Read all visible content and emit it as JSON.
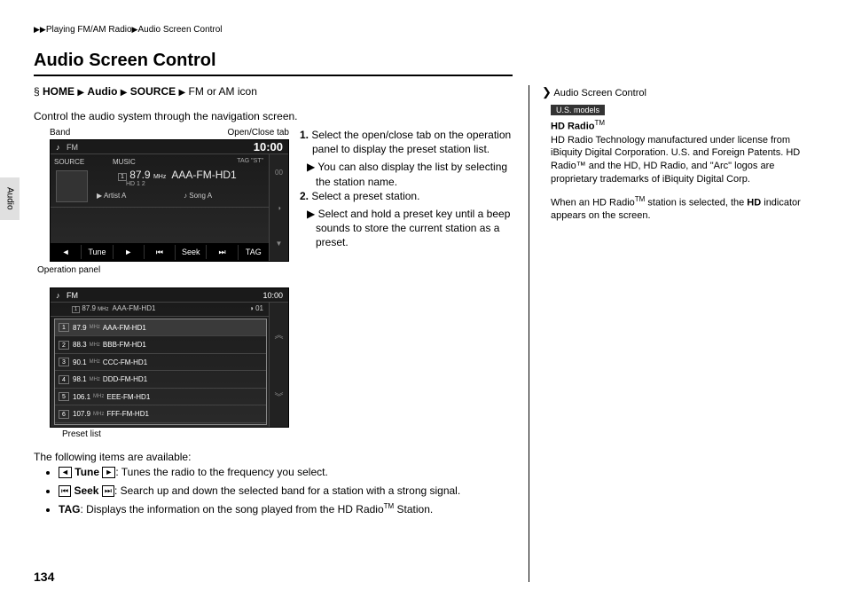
{
  "breadcrumb": {
    "section": "Playing FM/AM Radio",
    "sub": "Audio Screen Control"
  },
  "title": "Audio Screen Control",
  "side_tab": "Audio",
  "page_number": "134",
  "nav_path": {
    "home": "HOME",
    "audio": "Audio",
    "source": "SOURCE",
    "tail": "FM or AM icon"
  },
  "intro": "Control the audio system through the navigation screen.",
  "callouts": {
    "band": "Band",
    "open_close": "Open/Close tab",
    "operation_panel": "Operation panel",
    "preset_list": "Preset list"
  },
  "screen1": {
    "band": "FM",
    "clock": "10:00",
    "source": "SOURCE",
    "music": "MUSIC",
    "freq_num": "87.9",
    "freq_unit": "MHz",
    "station": "AAA-FM-HD1",
    "hd_ind": "HD 1 2",
    "artist_label": "Artist A",
    "song_label": "Song A",
    "tag_st": "TAG \"ST\"",
    "right_val": "00",
    "bottom": {
      "tune": "Tune",
      "seek": "Seek",
      "tag": "TAG"
    }
  },
  "screen2": {
    "band": "FM",
    "clock": "10:00",
    "now_freq": "87.9",
    "now_unit": "MHz",
    "now_station": "AAA-FM-HD1",
    "right_val": "01",
    "presets": [
      {
        "n": "1",
        "f": "87.9",
        "name": "AAA-FM-HD1"
      },
      {
        "n": "2",
        "f": "88.3",
        "name": "BBB-FM-HD1"
      },
      {
        "n": "3",
        "f": "90.1",
        "name": "CCC-FM-HD1"
      },
      {
        "n": "4",
        "f": "98.1",
        "name": "DDD-FM-HD1"
      },
      {
        "n": "5",
        "f": "106.1",
        "name": "EEE-FM-HD1"
      },
      {
        "n": "6",
        "f": "107.9",
        "name": "FFF-FM-HD1"
      }
    ]
  },
  "steps": {
    "s1": "Select the open/close tab on the operation panel to display the preset station list.",
    "s1sub": "You can also display the list by selecting the station name.",
    "s2": "Select a preset station.",
    "s2sub": "Select and hold a preset key until a beep sounds to store the current station as a preset.",
    "n1": "1.",
    "n2": "2."
  },
  "available": {
    "heading": "The following items are available:",
    "tune_label": "Tune",
    "tune_desc": ": Tunes the radio to the frequency you select.",
    "seek_label": "Seek",
    "seek_desc": ": Search up and down the selected band for a station with a strong signal.",
    "tag_label": "TAG",
    "tag_desc_a": ": Displays the information on the song played from the HD Radio",
    "tag_desc_b": " Station."
  },
  "sidebar": {
    "heading": "Audio Screen Control",
    "badge": "U.S. models",
    "hd_title": "HD Radio",
    "para1": "HD Radio Technology manufactured under license from iBiquity Digital Corporation. U.S. and Foreign Patents. HD Radio™ and the HD, HD Radio, and \"Arc\" logos are proprietary trademarks of iBiquity Digital Corp.",
    "para2a": "When an HD Radio",
    "para2b": " station is selected, the ",
    "para2_hd": "HD",
    "para2c": " indicator appears on the screen."
  }
}
